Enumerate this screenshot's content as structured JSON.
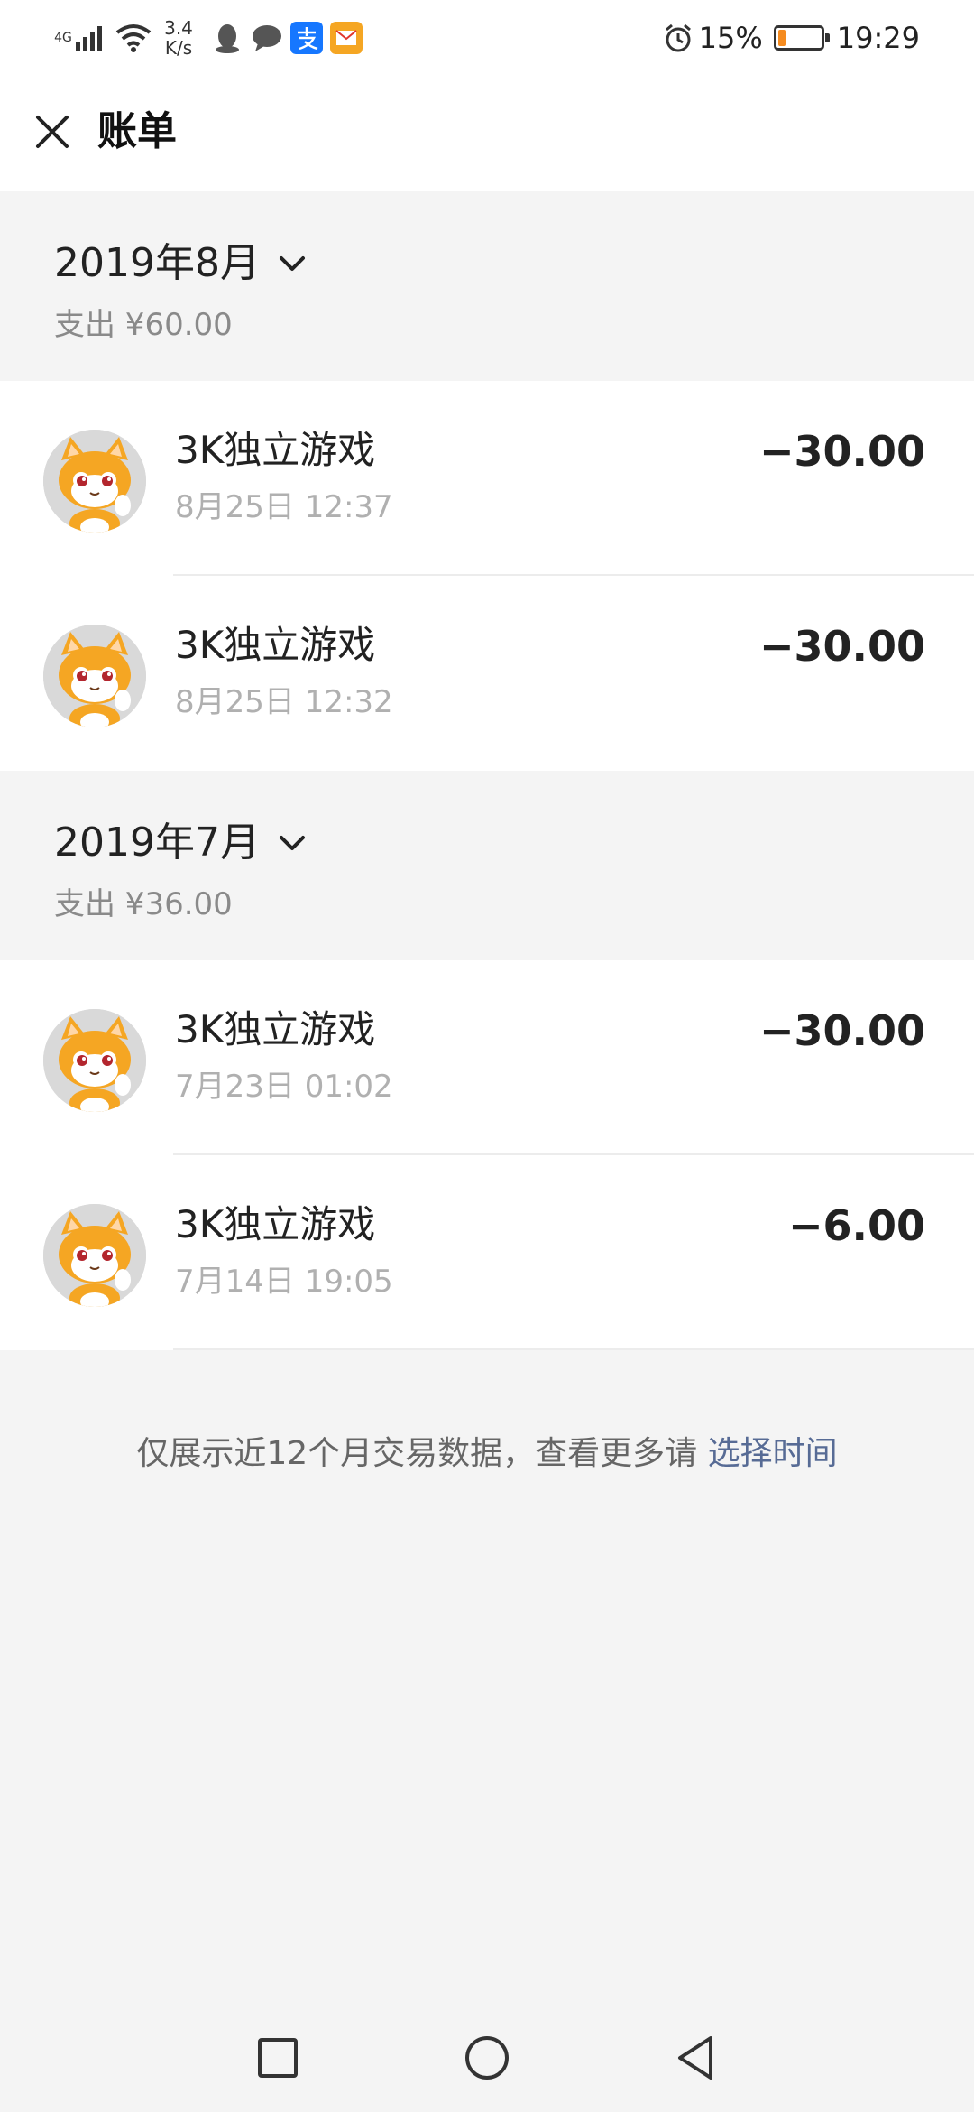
{
  "status_bar": {
    "network_type": "4G",
    "speed_value": "3.4",
    "speed_unit": "K/s",
    "battery_percent": "15%",
    "battery_level": 0.15,
    "time": "19:29",
    "notification_icons": [
      "qq-icon",
      "chat-bubble-icon",
      "alipay-icon",
      "mail-icon"
    ],
    "battery_color": "#f58b1f"
  },
  "header": {
    "title": "账单"
  },
  "months": [
    {
      "label": "2019年8月",
      "total": "支出 ¥60.00",
      "transactions": [
        {
          "name": "3K独立游戏",
          "time": "8月25日 12:37",
          "amount": "−30.00"
        },
        {
          "name": "3K独立游戏",
          "time": "8月25日 12:32",
          "amount": "−30.00"
        }
      ]
    },
    {
      "label": "2019年7月",
      "total": "支出 ¥36.00",
      "transactions": [
        {
          "name": "3K独立游戏",
          "time": "7月23日 01:02",
          "amount": "−30.00"
        },
        {
          "name": "3K独立游戏",
          "time": "7月14日 19:05",
          "amount": "−6.00"
        }
      ]
    }
  ],
  "footer": {
    "note": "仅展示近12个月交易数据，查看更多请 ",
    "link": "选择时间",
    "link_color": "#576b95"
  }
}
